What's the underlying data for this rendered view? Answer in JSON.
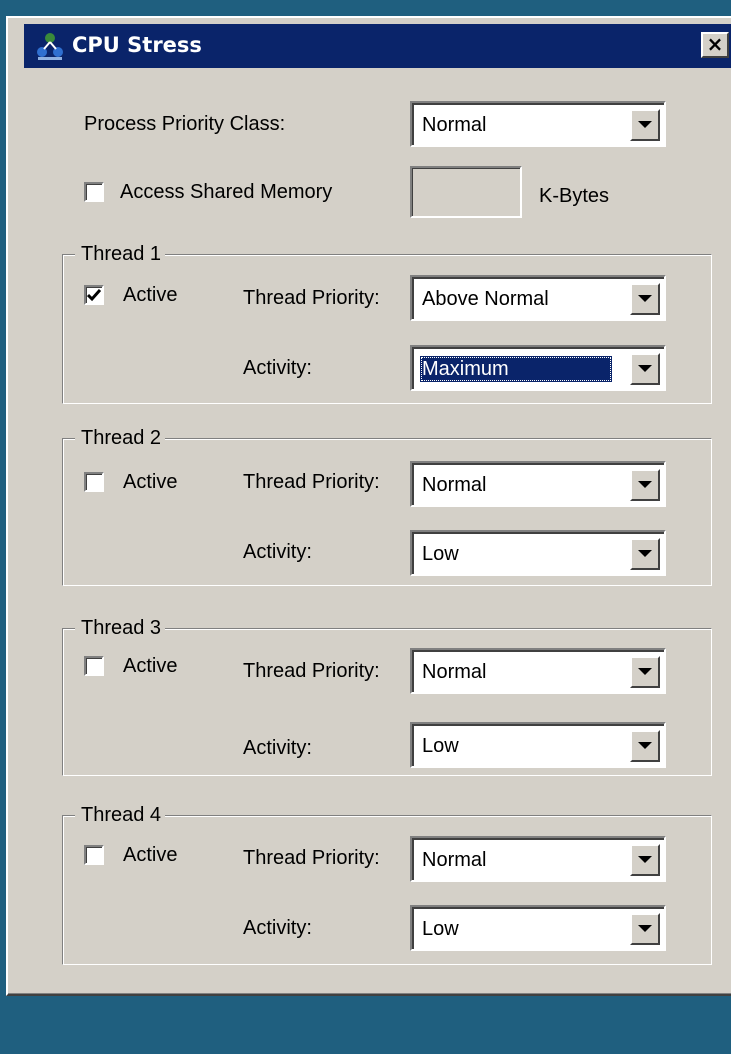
{
  "window": {
    "title": "CPU Stress",
    "close_label": "×"
  },
  "process": {
    "priority_label": "Process Priority Class:",
    "priority_value": "Normal",
    "shared_memory_label": "Access Shared Memory",
    "shared_memory_checked": false,
    "shared_memory_value": "",
    "units_label": "K-Bytes"
  },
  "threads": [
    {
      "title": "Thread 1",
      "active_label": "Active",
      "active": true,
      "priority_label": "Thread Priority:",
      "priority_value": "Above Normal",
      "activity_label": "Activity:",
      "activity_value": "Maximum",
      "activity_focused": true
    },
    {
      "title": "Thread 2",
      "active_label": "Active",
      "active": false,
      "priority_label": "Thread Priority:",
      "priority_value": "Normal",
      "activity_label": "Activity:",
      "activity_value": "Low"
    },
    {
      "title": "Thread 3",
      "active_label": "Active",
      "active": false,
      "priority_label": "Thread Priority:",
      "priority_value": "Normal",
      "activity_label": "Activity:",
      "activity_value": "Low"
    },
    {
      "title": "Thread 4",
      "active_label": "Active",
      "active": false,
      "priority_label": "Thread Priority:",
      "priority_value": "Normal",
      "activity_label": "Activity:",
      "activity_value": "Low"
    }
  ],
  "colors": {
    "titlebar": "#0a246a",
    "face": "#d4d0c8",
    "desktop": "#1f5f7f",
    "selection": "#0a246a"
  },
  "icons": {
    "app": "cpu-stress-app-icon",
    "dropdown": "chevron-down-icon",
    "check": "checkmark-icon"
  }
}
